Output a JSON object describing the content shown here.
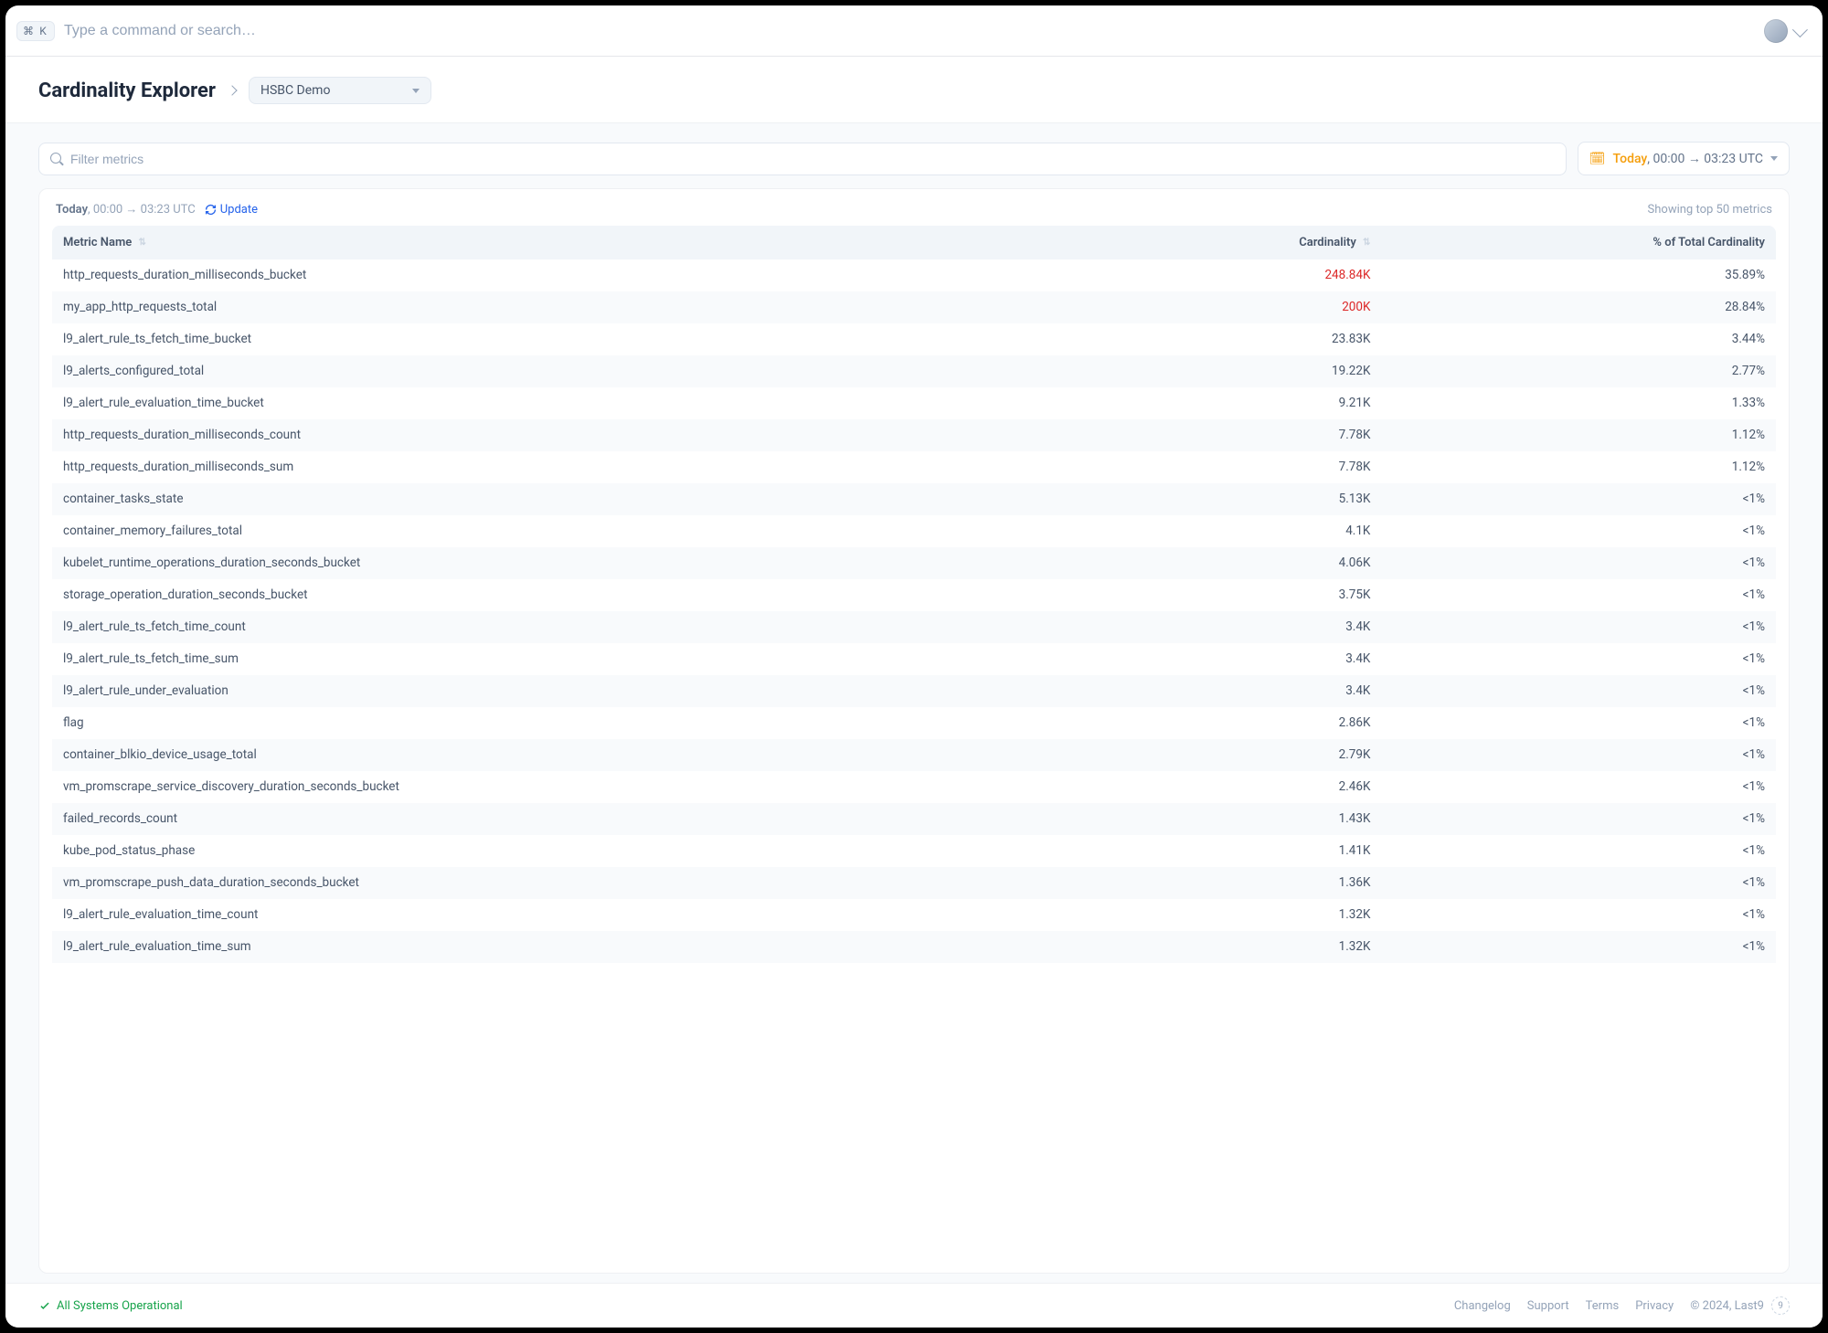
{
  "topbar": {
    "shortcut_symbol": "⌘",
    "shortcut_key": "K",
    "search_placeholder": "Type a command or search…"
  },
  "header": {
    "title": "Cardinality Explorer",
    "org_selected": "HSBC Demo"
  },
  "filters": {
    "filter_placeholder": "Filter metrics",
    "time_today_label": "Today",
    "time_range_suffix": ", 00:00 → 03:23 UTC"
  },
  "card": {
    "today_label": "Today",
    "range_label": ", 00:00 → 03:23 UTC",
    "update_label": "Update",
    "showing_label": "Showing top 50 metrics",
    "columns": {
      "name": "Metric Name",
      "cardinality": "Cardinality",
      "pct": "% of Total Cardinality"
    },
    "rows": [
      {
        "name": "http_requests_duration_milliseconds_bucket",
        "cardinality": "248.84K",
        "pct": "35.89%",
        "hot": true
      },
      {
        "name": "my_app_http_requests_total",
        "cardinality": "200K",
        "pct": "28.84%",
        "hot": true
      },
      {
        "name": "l9_alert_rule_ts_fetch_time_bucket",
        "cardinality": "23.83K",
        "pct": "3.44%"
      },
      {
        "name": "l9_alerts_configured_total",
        "cardinality": "19.22K",
        "pct": "2.77%"
      },
      {
        "name": "l9_alert_rule_evaluation_time_bucket",
        "cardinality": "9.21K",
        "pct": "1.33%"
      },
      {
        "name": "http_requests_duration_milliseconds_count",
        "cardinality": "7.78K",
        "pct": "1.12%"
      },
      {
        "name": "http_requests_duration_milliseconds_sum",
        "cardinality": "7.78K",
        "pct": "1.12%"
      },
      {
        "name": "container_tasks_state",
        "cardinality": "5.13K",
        "pct": "<1%"
      },
      {
        "name": "container_memory_failures_total",
        "cardinality": "4.1K",
        "pct": "<1%"
      },
      {
        "name": "kubelet_runtime_operations_duration_seconds_bucket",
        "cardinality": "4.06K",
        "pct": "<1%"
      },
      {
        "name": "storage_operation_duration_seconds_bucket",
        "cardinality": "3.75K",
        "pct": "<1%"
      },
      {
        "name": "l9_alert_rule_ts_fetch_time_count",
        "cardinality": "3.4K",
        "pct": "<1%"
      },
      {
        "name": "l9_alert_rule_ts_fetch_time_sum",
        "cardinality": "3.4K",
        "pct": "<1%"
      },
      {
        "name": "l9_alert_rule_under_evaluation",
        "cardinality": "3.4K",
        "pct": "<1%"
      },
      {
        "name": "flag",
        "cardinality": "2.86K",
        "pct": "<1%"
      },
      {
        "name": "container_blkio_device_usage_total",
        "cardinality": "2.79K",
        "pct": "<1%"
      },
      {
        "name": "vm_promscrape_service_discovery_duration_seconds_bucket",
        "cardinality": "2.46K",
        "pct": "<1%"
      },
      {
        "name": "failed_records_count",
        "cardinality": "1.43K",
        "pct": "<1%"
      },
      {
        "name": "kube_pod_status_phase",
        "cardinality": "1.41K",
        "pct": "<1%"
      },
      {
        "name": "vm_promscrape_push_data_duration_seconds_bucket",
        "cardinality": "1.36K",
        "pct": "<1%"
      },
      {
        "name": "l9_alert_rule_evaluation_time_count",
        "cardinality": "1.32K",
        "pct": "<1%"
      },
      {
        "name": "l9_alert_rule_evaluation_time_sum",
        "cardinality": "1.32K",
        "pct": "<1%"
      }
    ]
  },
  "footer": {
    "status_label": "All Systems Operational",
    "links": [
      "Changelog",
      "Support",
      "Terms",
      "Privacy"
    ],
    "copyright": "© 2024, Last9",
    "logo_char": "9"
  }
}
